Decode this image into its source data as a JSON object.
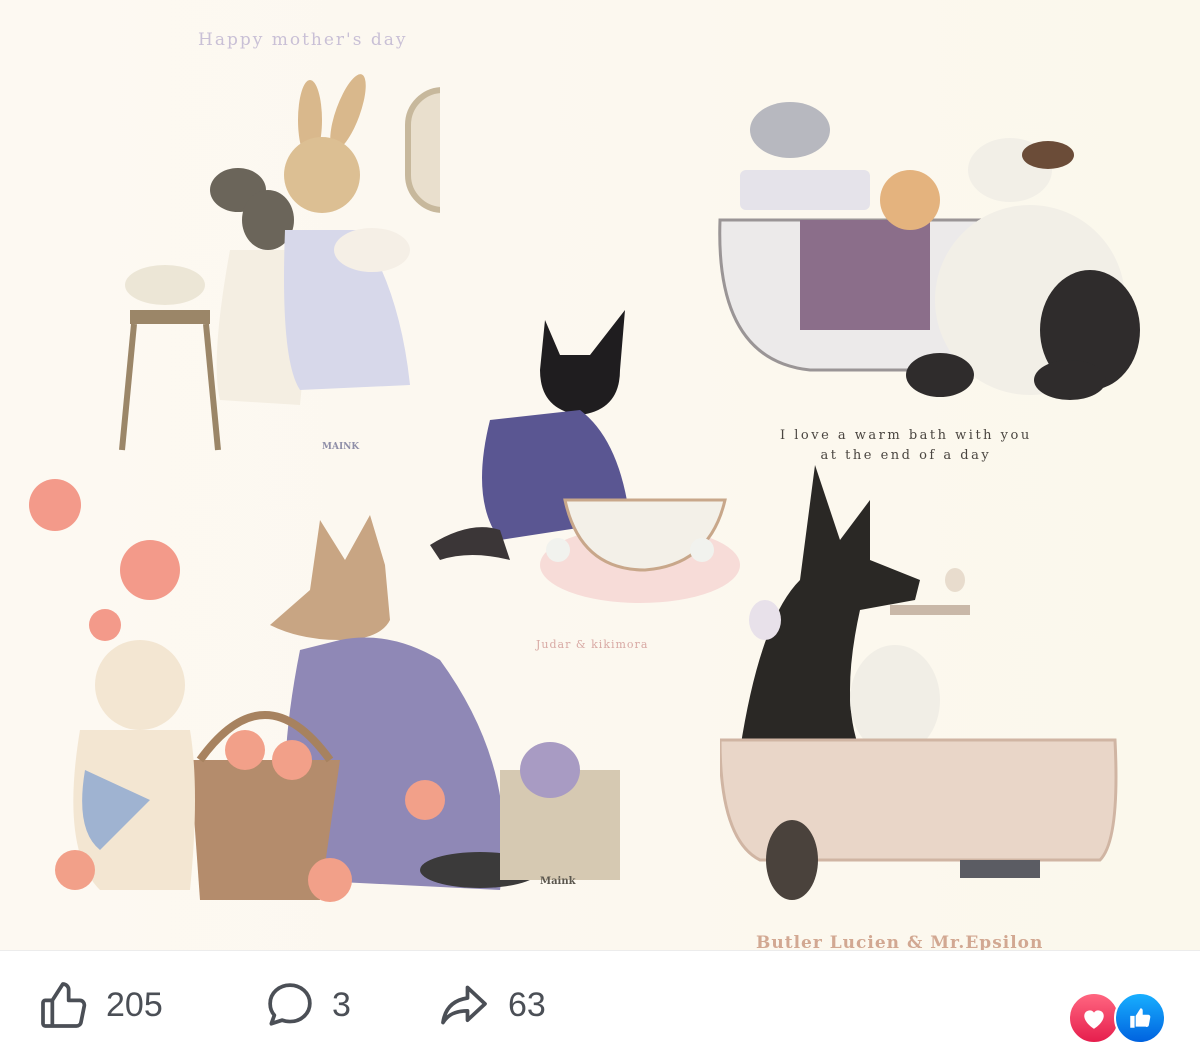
{
  "post": {
    "image": {
      "captions": {
        "mother_day": "Happy mother's day",
        "warm_bath": "I love a warm bath with you\nat the end of a day",
        "judar": "Judar & kikimora",
        "signature_1": "MAINK",
        "signature_2": "Maink",
        "butler": "Butler Lucien & Mr.Epsilon"
      }
    },
    "actions": {
      "like": {
        "icon": "thumbs-up-icon",
        "count": "205"
      },
      "comment": {
        "icon": "comment-bubble-icon",
        "count": "3"
      },
      "share": {
        "icon": "share-arrow-icon",
        "count": "63"
      }
    },
    "reactions": [
      {
        "type": "love",
        "icon": "heart-icon",
        "color": "#f33e58"
      },
      {
        "type": "like",
        "icon": "thumbs-up-icon",
        "color": "#1877f2"
      }
    ]
  }
}
